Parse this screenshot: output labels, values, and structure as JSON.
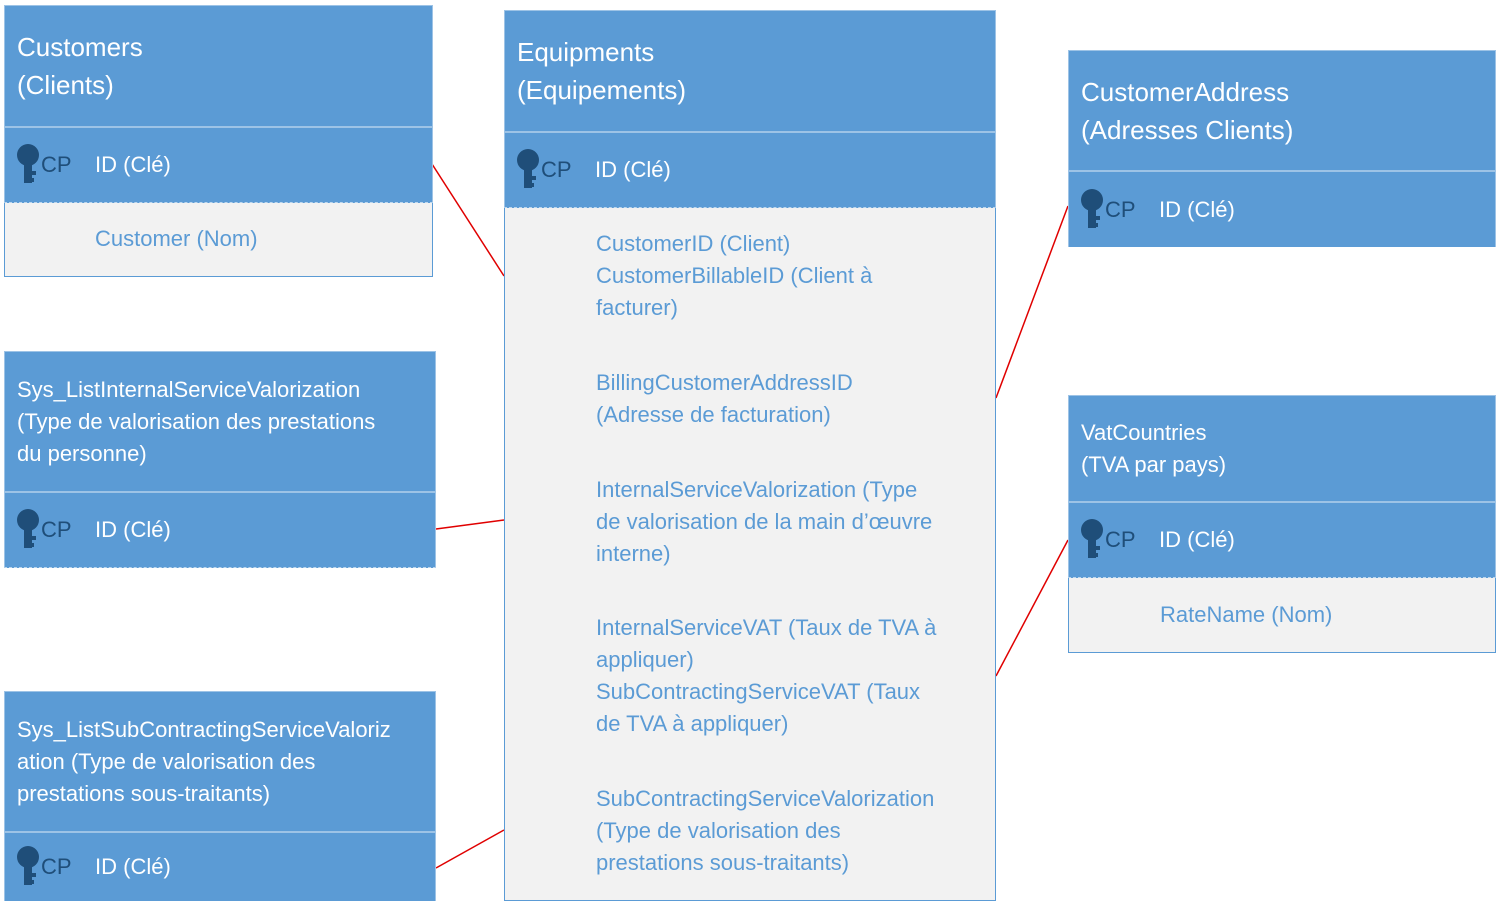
{
  "colors": {
    "header": "#5b9bd5",
    "body": "#f2f2f2",
    "key": "#1f4e79",
    "field_text": "#5b9bd5",
    "link": "#e00000"
  },
  "pk": {
    "tag": "CP",
    "label": "ID (Clé)"
  },
  "customers": {
    "title": [
      "Customers",
      "(Clients)"
    ],
    "fields": [
      [
        "Customer (Nom)"
      ]
    ]
  },
  "internal_valorization": {
    "title": [
      "Sys_ListInternalServiceValorization",
      "(Type de valorisation des prestations",
      "du personne)"
    ]
  },
  "subcontracting_valorization": {
    "title": [
      "Sys_ListSubContractingServiceValoriz",
      "ation (Type de valorisation des",
      "prestations sous-traitants)"
    ]
  },
  "equipments": {
    "title": [
      "Equipments",
      "(Equipements)"
    ],
    "fields": [
      [
        "CustomerID (Client)",
        "CustomerBillableID (Client à",
        "facturer)"
      ],
      [
        "BillingCustomerAddressID",
        "(Adresse de facturation)"
      ],
      [
        "InternalServiceValorization (Type",
        "de valorisation de la main d’œuvre",
        "interne)"
      ],
      [
        "InternalServiceVAT (Taux de TVA à",
        "appliquer)",
        "SubContractingServiceVAT (Taux",
        "de TVA à appliquer)"
      ],
      [
        "SubContractingServiceValorization",
        "(Type de valorisation des",
        "prestations sous-traitants)"
      ]
    ]
  },
  "customer_address": {
    "title": [
      "CustomerAddress",
      "(Adresses Clients)"
    ]
  },
  "vat_countries": {
    "title": [
      "VatCountries",
      "(TVA par pays)"
    ],
    "fields": [
      [
        "RateName (Nom)"
      ]
    ]
  }
}
